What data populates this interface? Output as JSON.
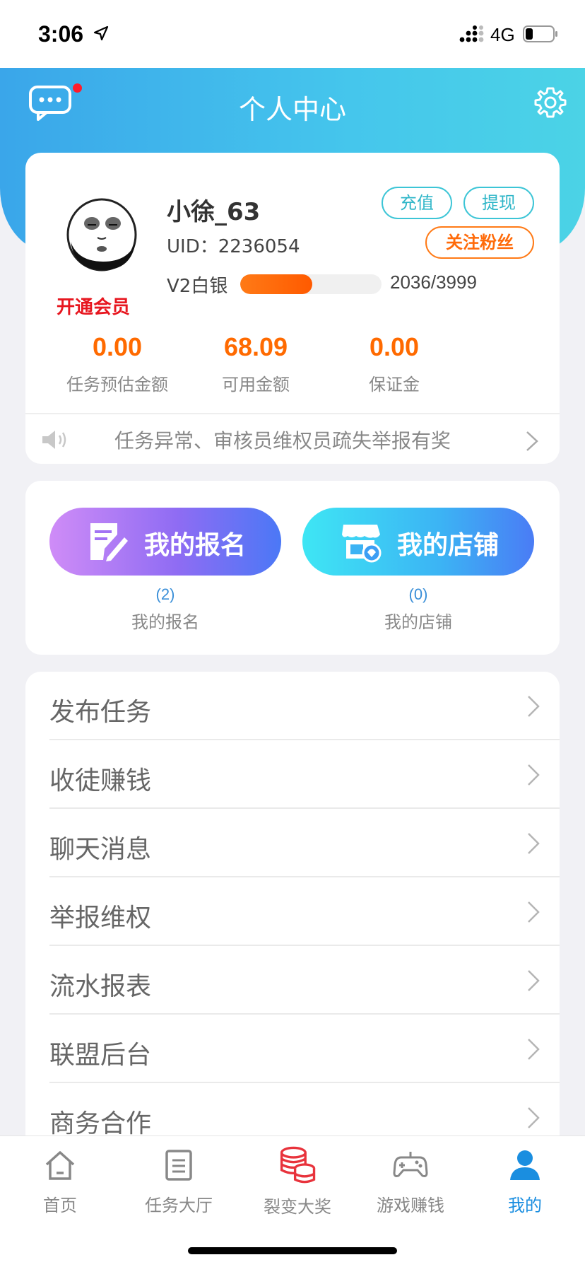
{
  "status_bar": {
    "time": "3:06",
    "network": "4G"
  },
  "header": {
    "title": "个人中心",
    "icons": [
      "message-icon",
      "gear-icon"
    ]
  },
  "profile": {
    "username": "小徐_63",
    "uid": "UID：2236054",
    "vip_link": "开通会员",
    "level": "V2白银",
    "level_progress_text": "2036/3999",
    "level_progress_fraction": 0.51,
    "buttons": {
      "recharge": "充值",
      "withdraw": "提现",
      "follow": "关注粉丝"
    },
    "stats": [
      {
        "value": "0.00",
        "label": "任务预估金额"
      },
      {
        "value": "68.09",
        "label": "可用金额"
      },
      {
        "value": "0.00",
        "label": "保证金"
      }
    ],
    "notice": "任务异常、审核员维权员疏失举报有奖"
  },
  "shortcuts": [
    {
      "label": "我的报名",
      "count": "(2)",
      "sub": "我的报名",
      "icon": "edit-icon"
    },
    {
      "label": "我的店铺",
      "count": "(0)",
      "sub": "我的店铺",
      "icon": "store-icon"
    }
  ],
  "menu": [
    {
      "label": "发布任务"
    },
    {
      "label": "收徒赚钱"
    },
    {
      "label": "聊天消息"
    },
    {
      "label": "举报维权"
    },
    {
      "label": "流水报表"
    },
    {
      "label": "联盟后台"
    },
    {
      "label": "商务合作"
    }
  ],
  "tabbar": [
    {
      "label": "首页",
      "icon": "home-icon"
    },
    {
      "label": "任务大厅",
      "icon": "task-list-icon"
    },
    {
      "label": "裂变大奖",
      "icon": "coins-icon"
    },
    {
      "label": "游戏赚钱",
      "icon": "gamepad-icon"
    },
    {
      "label": "我的",
      "icon": "user-icon",
      "active": true
    }
  ],
  "colors": {
    "accent": "#1a8ee0",
    "orange": "#ff6a00",
    "header": "#3aa6ea",
    "red": "#e7161f"
  }
}
